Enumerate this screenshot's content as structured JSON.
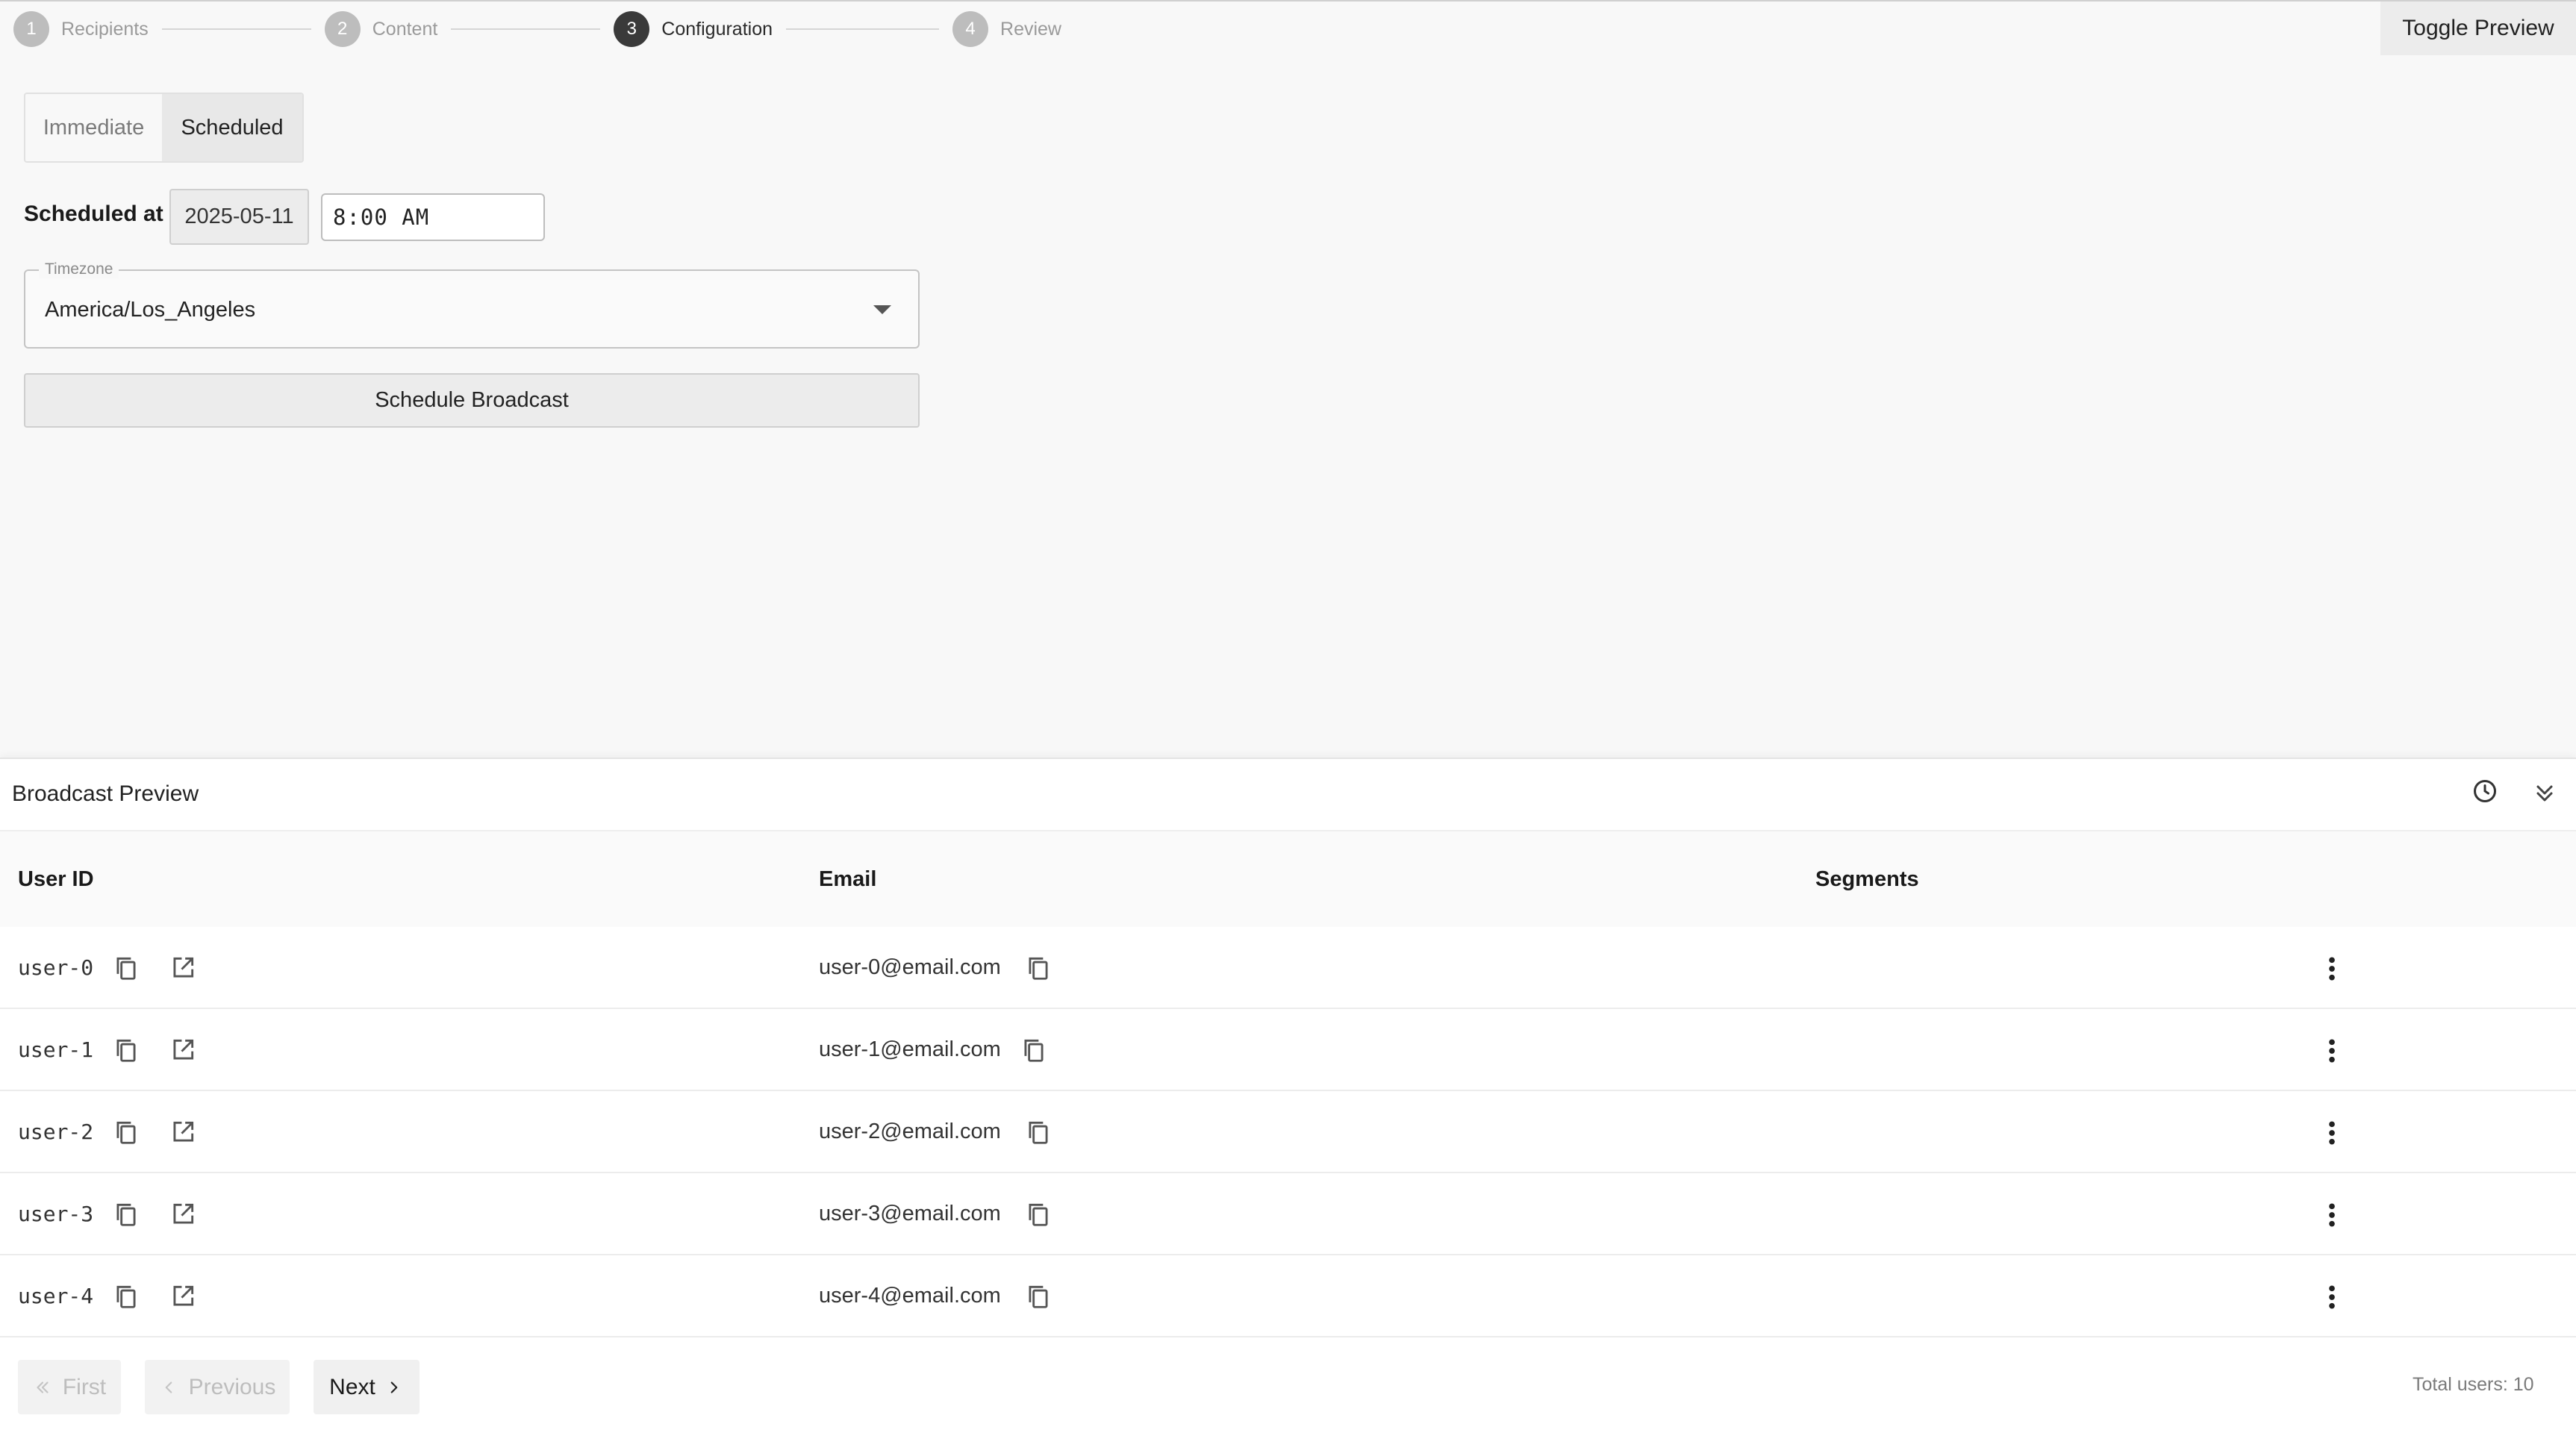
{
  "stepper": {
    "steps": [
      {
        "num": "1",
        "label": "Recipients"
      },
      {
        "num": "2",
        "label": "Content"
      },
      {
        "num": "3",
        "label": "Configuration"
      },
      {
        "num": "4",
        "label": "Review"
      }
    ],
    "active_step": 3
  },
  "toggle_preview_label": "Toggle Preview",
  "mode_tabs": {
    "immediate": "Immediate",
    "scheduled": "Scheduled",
    "selected": "Scheduled"
  },
  "schedule": {
    "label": "Scheduled at",
    "date": "2025-05-11",
    "time": "8:00 AM"
  },
  "timezone": {
    "legend": "Timezone",
    "value": "America/Los_Angeles"
  },
  "schedule_button": "Schedule Broadcast",
  "preview": {
    "title": "Broadcast Preview",
    "columns": {
      "user_id": "User ID",
      "email": "Email",
      "segments": "Segments"
    },
    "rows": [
      {
        "user_id": "user-0",
        "email": "user-0@email.com",
        "segments": ""
      },
      {
        "user_id": "user-1",
        "email": "user-1@email.com",
        "segments": ""
      },
      {
        "user_id": "user-2",
        "email": "user-2@email.com",
        "segments": ""
      },
      {
        "user_id": "user-3",
        "email": "user-3@email.com",
        "segments": ""
      },
      {
        "user_id": "user-4",
        "email": "user-4@email.com",
        "segments": ""
      }
    ]
  },
  "pagination": {
    "first": "First",
    "previous": "Previous",
    "next": "Next",
    "total": "Total users: 10"
  },
  "icons": {
    "copy": "copy-icon",
    "open": "open-in-new-icon",
    "history": "history-icon",
    "collapse": "chevron-double-down-icon",
    "menu": "more-vert-icon"
  }
}
